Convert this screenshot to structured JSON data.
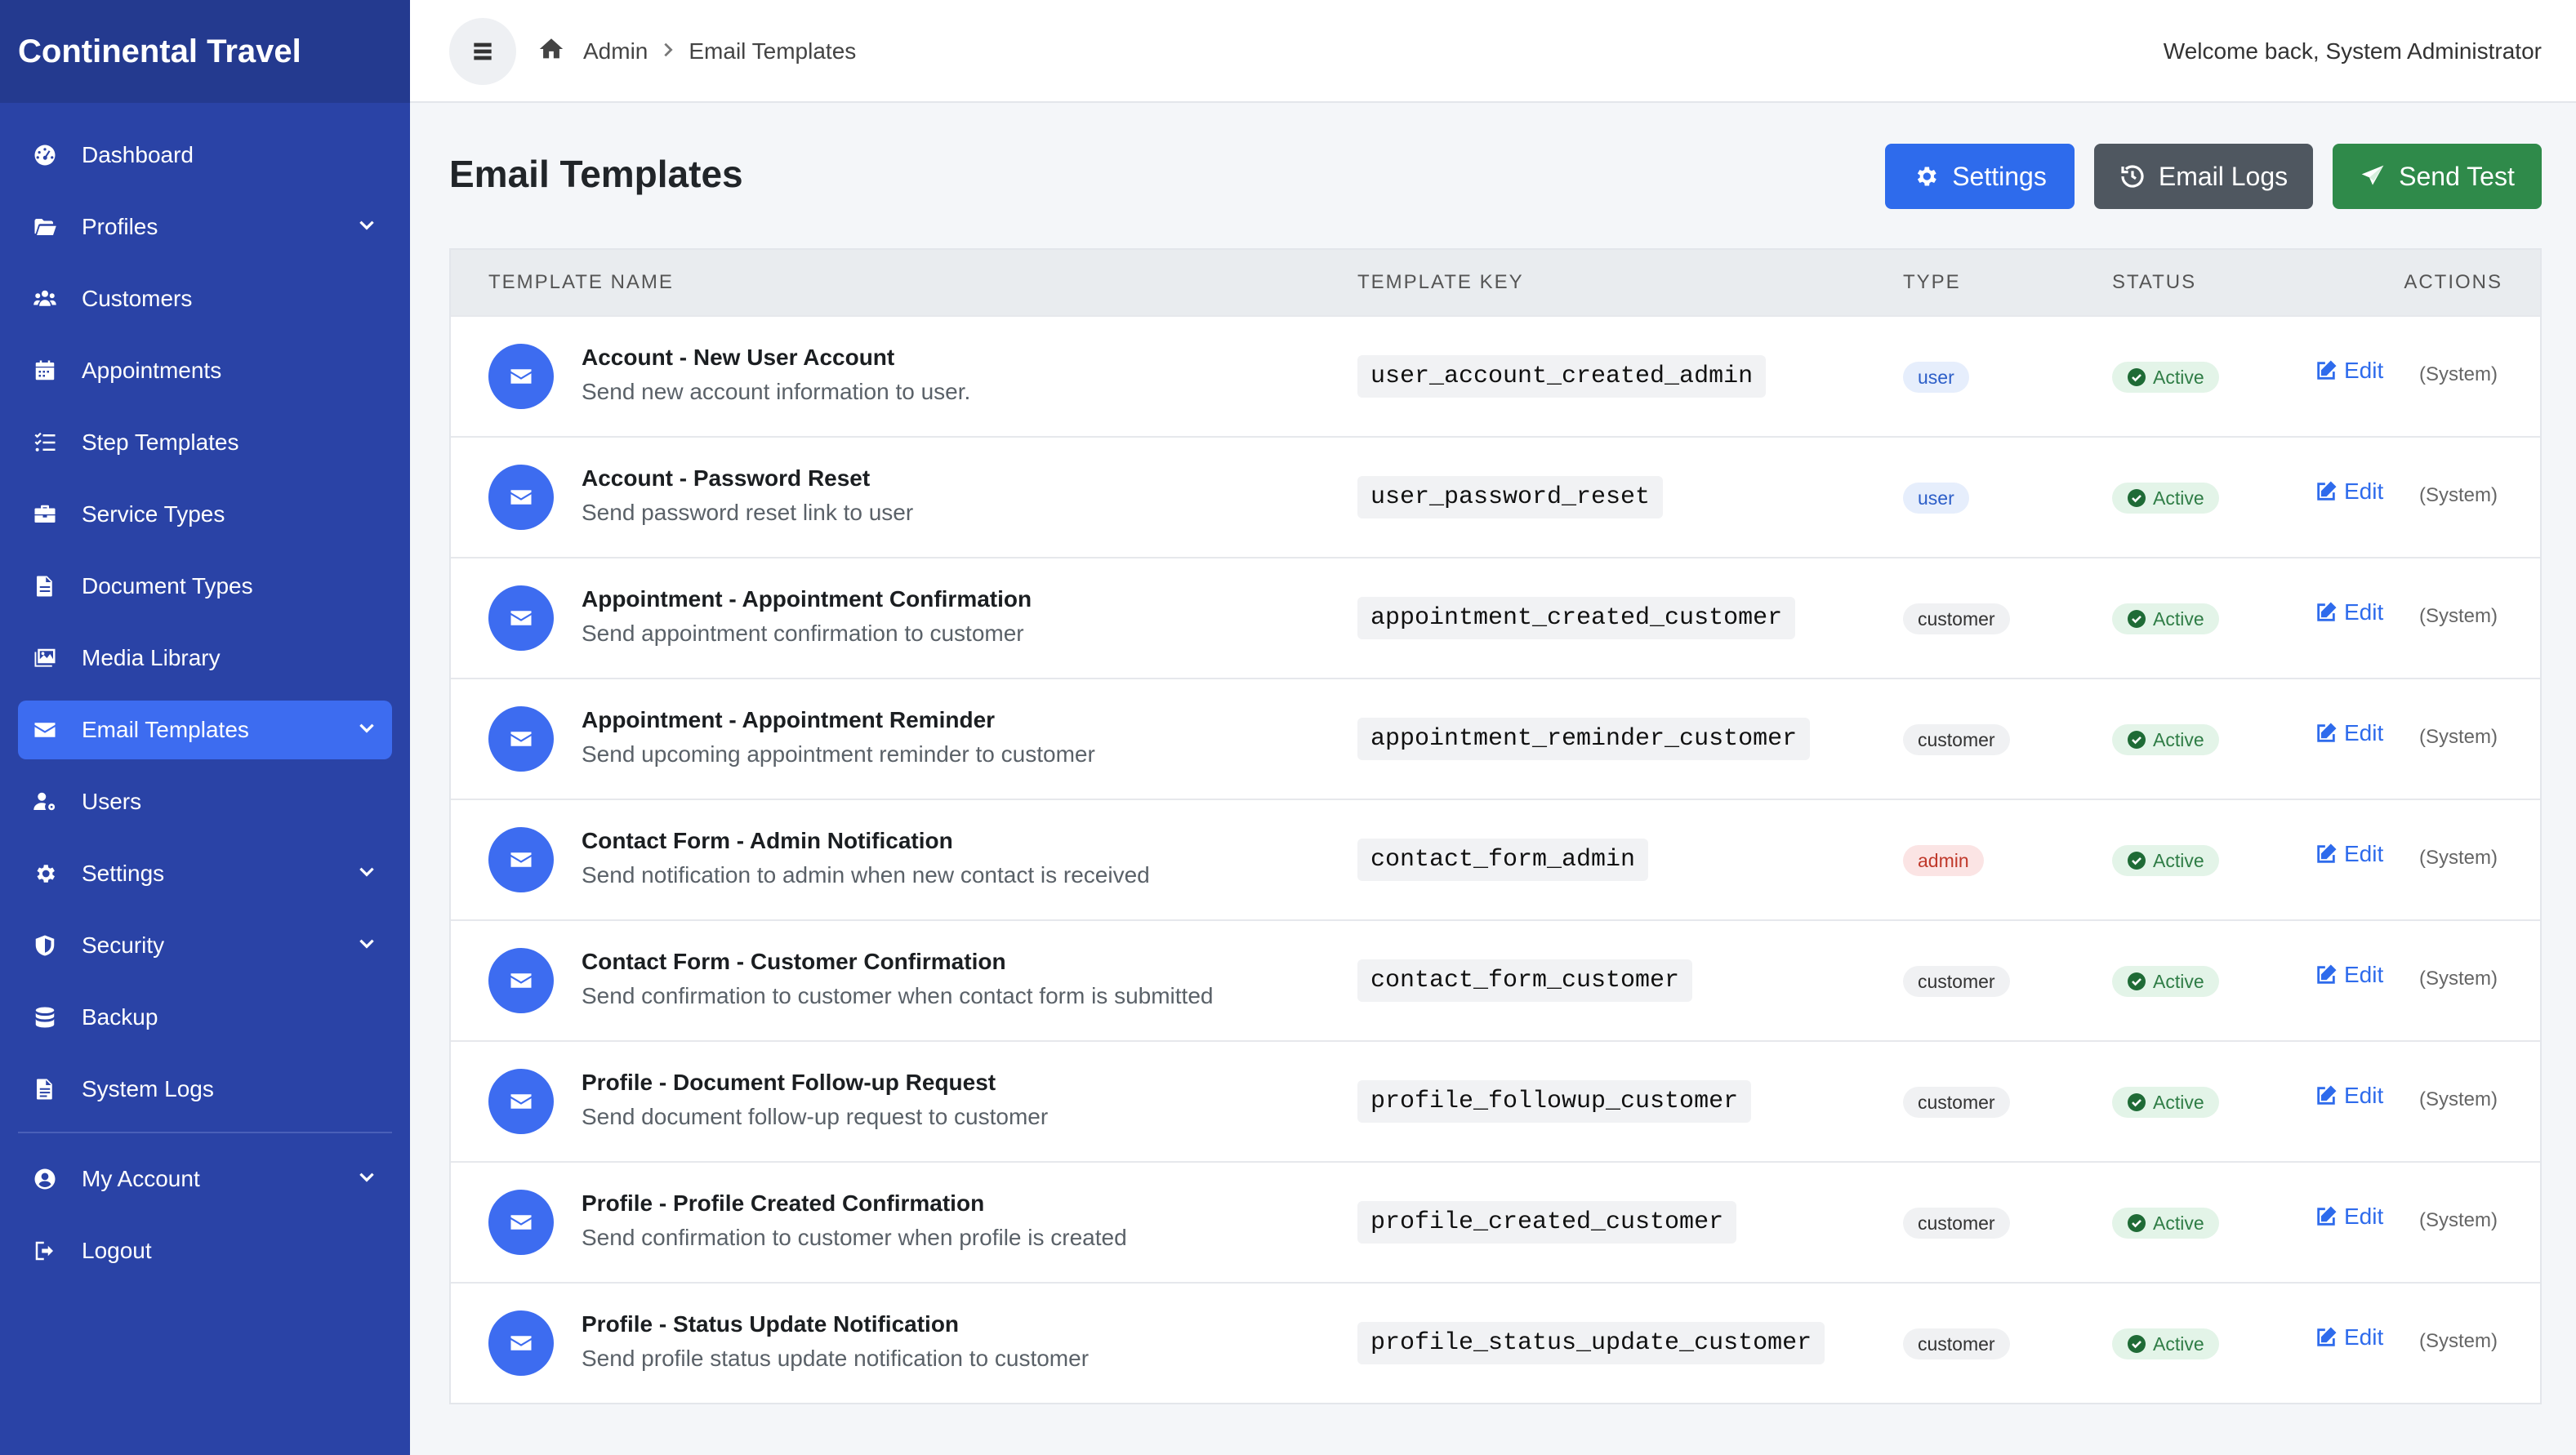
{
  "app": {
    "title": "Continental Travel"
  },
  "sidebar": {
    "items": [
      {
        "label": "Dashboard",
        "icon": "dashboard-icon"
      },
      {
        "label": "Profiles",
        "icon": "folder-open-icon",
        "has_submenu": true
      },
      {
        "label": "Customers",
        "icon": "users-icon"
      },
      {
        "label": "Appointments",
        "icon": "calendar-icon"
      },
      {
        "label": "Step Templates",
        "icon": "list-check-icon"
      },
      {
        "label": "Service Types",
        "icon": "briefcase-icon"
      },
      {
        "label": "Document Types",
        "icon": "file-icon"
      },
      {
        "label": "Media Library",
        "icon": "images-icon"
      },
      {
        "label": "Email Templates",
        "icon": "envelope-icon",
        "has_submenu": true,
        "active": true
      },
      {
        "label": "Users",
        "icon": "user-gear-icon"
      },
      {
        "label": "Settings",
        "icon": "gear-icon",
        "has_submenu": true
      },
      {
        "label": "Security",
        "icon": "shield-icon",
        "has_submenu": true
      },
      {
        "label": "Backup",
        "icon": "database-icon"
      },
      {
        "label": "System Logs",
        "icon": "file-lines-icon"
      }
    ],
    "account_items": [
      {
        "label": "My Account",
        "icon": "user-circle-icon",
        "has_submenu": true
      },
      {
        "label": "Logout",
        "icon": "logout-icon"
      }
    ]
  },
  "topbar": {
    "breadcrumb": [
      "Admin",
      "Email Templates"
    ],
    "welcome": "Welcome back, System Administrator"
  },
  "page": {
    "title": "Email Templates",
    "buttons": {
      "settings": "Settings",
      "email_logs": "Email Logs",
      "send_test": "Send Test"
    }
  },
  "table": {
    "headers": {
      "name": "TEMPLATE NAME",
      "key": "TEMPLATE KEY",
      "type": "TYPE",
      "status": "STATUS",
      "actions": "ACTIONS"
    },
    "edit_label": "Edit",
    "system_label": "(System)",
    "rows": [
      {
        "name": "Account - New User Account",
        "desc": "Send new account information to user.",
        "key": "user_account_created_admin",
        "type": "user",
        "status": "Active"
      },
      {
        "name": "Account - Password Reset",
        "desc": "Send password reset link to user",
        "key": "user_password_reset",
        "type": "user",
        "status": "Active"
      },
      {
        "name": "Appointment - Appointment Confirmation",
        "desc": "Send appointment confirmation to customer",
        "key": "appointment_created_customer",
        "type": "customer",
        "status": "Active"
      },
      {
        "name": "Appointment - Appointment Reminder",
        "desc": "Send upcoming appointment reminder to customer",
        "key": "appointment_reminder_customer",
        "type": "customer",
        "status": "Active"
      },
      {
        "name": "Contact Form - Admin Notification",
        "desc": "Send notification to admin when new contact is received",
        "key": "contact_form_admin",
        "type": "admin",
        "status": "Active"
      },
      {
        "name": "Contact Form - Customer Confirmation",
        "desc": "Send confirmation to customer when contact form is submitted",
        "key": "contact_form_customer",
        "type": "customer",
        "status": "Active"
      },
      {
        "name": "Profile - Document Follow-up Request",
        "desc": "Send document follow-up request to customer",
        "key": "profile_followup_customer",
        "type": "customer",
        "status": "Active"
      },
      {
        "name": "Profile - Profile Created Confirmation",
        "desc": "Send confirmation to customer when profile is created",
        "key": "profile_created_customer",
        "type": "customer",
        "status": "Active"
      },
      {
        "name": "Profile - Status Update Notification",
        "desc": "Send profile status update notification to customer",
        "key": "profile_status_update_customer",
        "type": "customer",
        "status": "Active"
      }
    ]
  },
  "colors": {
    "sidebar_bg": "#2a43a6",
    "brand_bg": "#243a8f",
    "active_item": "#3d6cf0",
    "primary": "#2e6bec",
    "secondary": "#4f5760",
    "success": "#2f8a4a"
  }
}
